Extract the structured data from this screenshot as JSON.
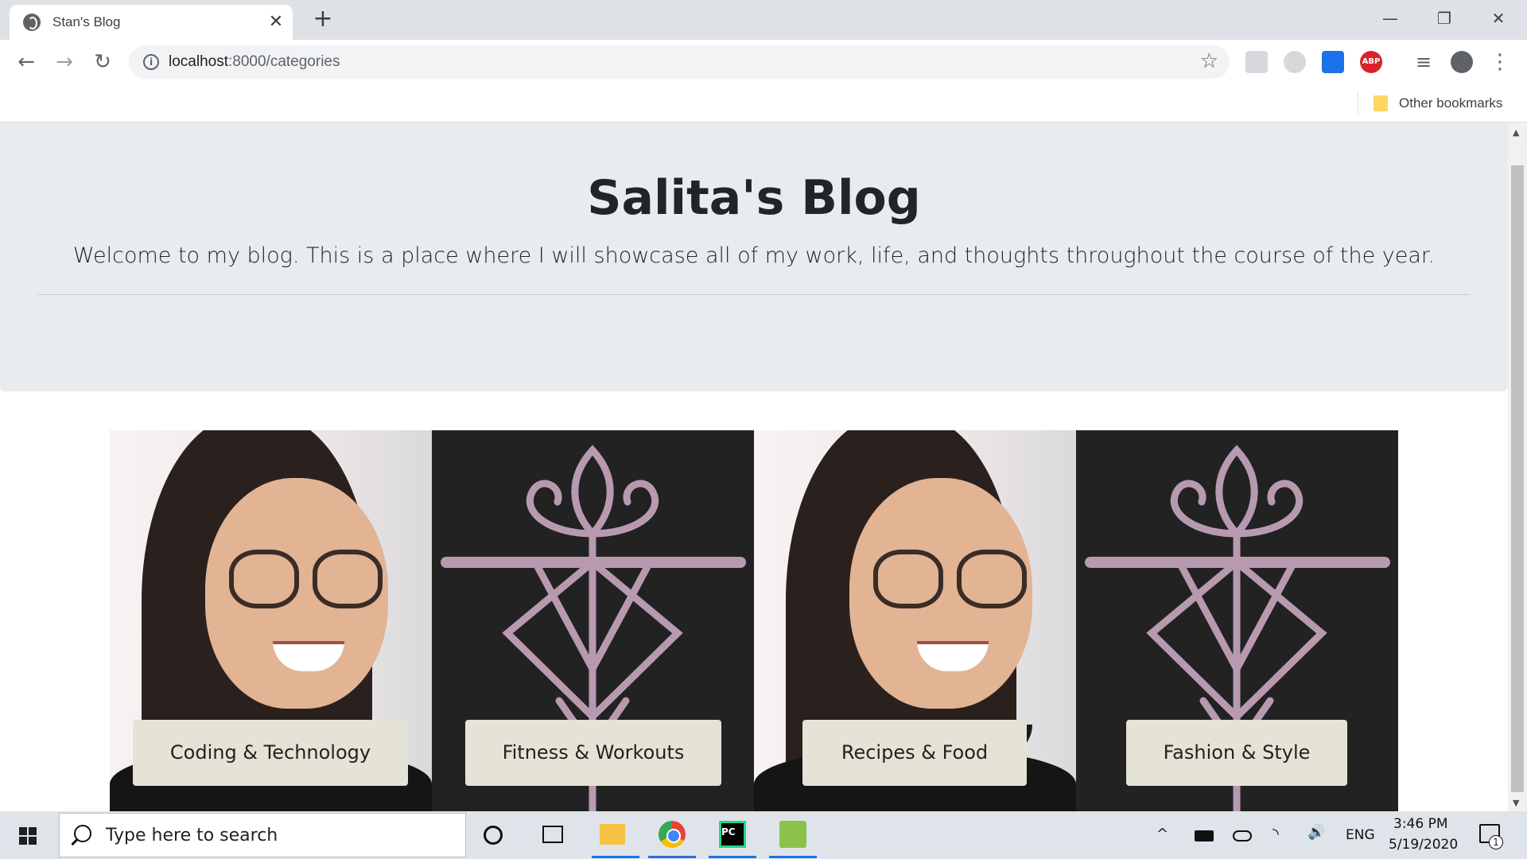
{
  "browser": {
    "tab_title": "Stan's Blog",
    "tab_close": "✕",
    "new_tab": "+",
    "win_minimize": "—",
    "win_restore": "❐",
    "win_close": "✕",
    "url_host": "localhost",
    "url_path": ":8000/categories",
    "back": "←",
    "forward": "→",
    "reload": "↻",
    "star": "☆",
    "abp_label": "ABP",
    "menu": "⋮",
    "media": "≡",
    "bookmarks_label": "Other bookmarks"
  },
  "page": {
    "title": "Salita's Blog",
    "lead": "Welcome to my blog. This is a place where I will showcase all of my work, life, and thoughts throughout the course of the year.",
    "categories": [
      {
        "label": "Coding & Technology",
        "image": "portrait-photo"
      },
      {
        "label": "Fitness & Workouts",
        "image": "emblem-logo"
      },
      {
        "label": "Recipes & Food",
        "image": "portrait-photo"
      },
      {
        "label": "Fashion & Style",
        "image": "emblem-logo"
      }
    ],
    "colors": {
      "jumbotron": "#e9ecef",
      "card_button": "#e5e3d6",
      "emblem_bg": "#222222",
      "emblem_mark": "#b89ab0"
    }
  },
  "taskbar": {
    "search_placeholder": "Type here to search",
    "language": "ENG",
    "time": "3:46 PM",
    "date": "5/19/2020",
    "notification_count": "1",
    "tray_chevron": "^",
    "volume": "🔊"
  }
}
